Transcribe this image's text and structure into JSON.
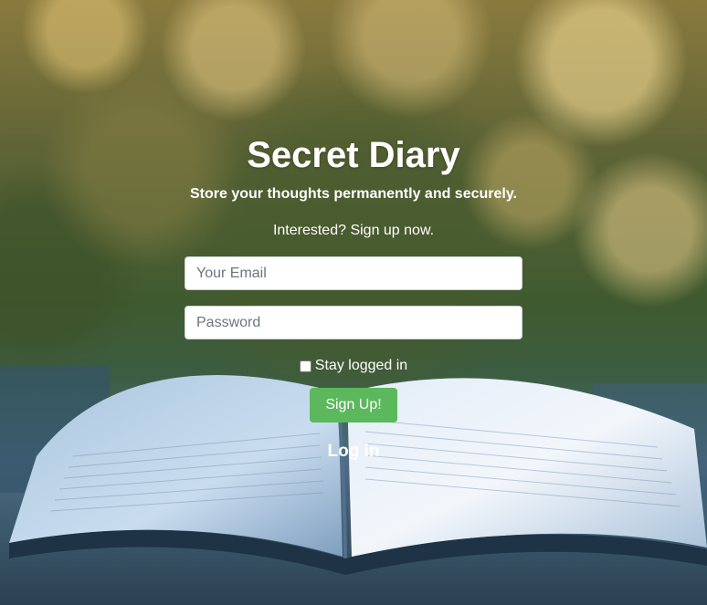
{
  "page": {
    "title": "Secret Diary",
    "subtitle": "Store your thoughts permanently and securely.",
    "cta": "Interested? Sign up now."
  },
  "form": {
    "email_placeholder": "Your Email",
    "email_value": "",
    "password_placeholder": "Password",
    "password_value": "",
    "stay_logged_in_label": "Stay logged in",
    "stay_logged_in_checked": false,
    "submit_label": "Sign Up!",
    "toggle_link_label": "Log in"
  },
  "colors": {
    "submit_button": "#5cb85c",
    "text": "#ffffff"
  }
}
